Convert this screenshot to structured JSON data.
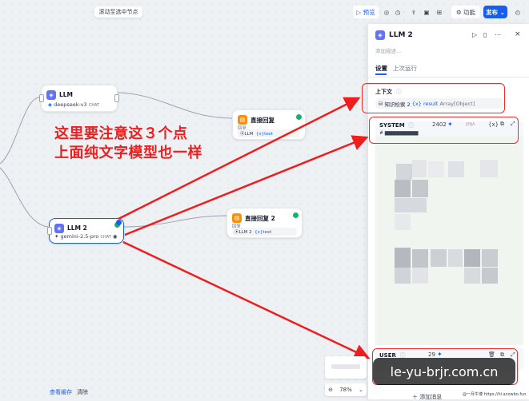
{
  "toolbar": {
    "scroll_to_node": "滚动至选中节点",
    "preview": "预览",
    "features": "功能",
    "publish": "发布"
  },
  "nodes": {
    "llm1": {
      "title": "LLM",
      "model": "deepseek-v3",
      "tag": "CHAT"
    },
    "reply1": {
      "title": "直接回复",
      "label": "回复",
      "var_src": "LLM",
      "var_name": "text"
    },
    "llm2": {
      "title": "LLM 2",
      "model": "gemini-2.5-pro",
      "tag": "CHAT"
    },
    "reply2": {
      "title": "直接回复 2",
      "label": "回复",
      "var_src": "LLM 2",
      "var_name": "text"
    }
  },
  "annotation": {
    "line1": "这里要注意这３个点",
    "line2": "上面纯文字模型也一样"
  },
  "panel": {
    "title": "LLM 2",
    "desc_placeholder": "添加描述...",
    "tabs": [
      {
        "label": "设置"
      },
      {
        "label": "上次运行"
      }
    ],
    "context": {
      "label": "上下文",
      "source": "知识检索 2",
      "var": "result",
      "type": "Array[Object]"
    },
    "system": {
      "label": "SYSTEM",
      "count": "2402",
      "jinja": "JINJA"
    },
    "user": {
      "label": "USER",
      "count": "29"
    },
    "add_message": "添加消息"
  },
  "bottom": {
    "view_cache": "查看缓存",
    "clear": "清除",
    "zoom": "78%"
  },
  "watermark": {
    "main": "le-yu-brjr.com.cn",
    "small": "@一月牛博 https://hi.acowbo.fun"
  },
  "colors": {
    "accent": "#155eef",
    "annotation_red": "#ef1d1d",
    "llm_icon": "#6172f3",
    "reply_icon": "#f79009",
    "ok_green": "#17b26a"
  }
}
